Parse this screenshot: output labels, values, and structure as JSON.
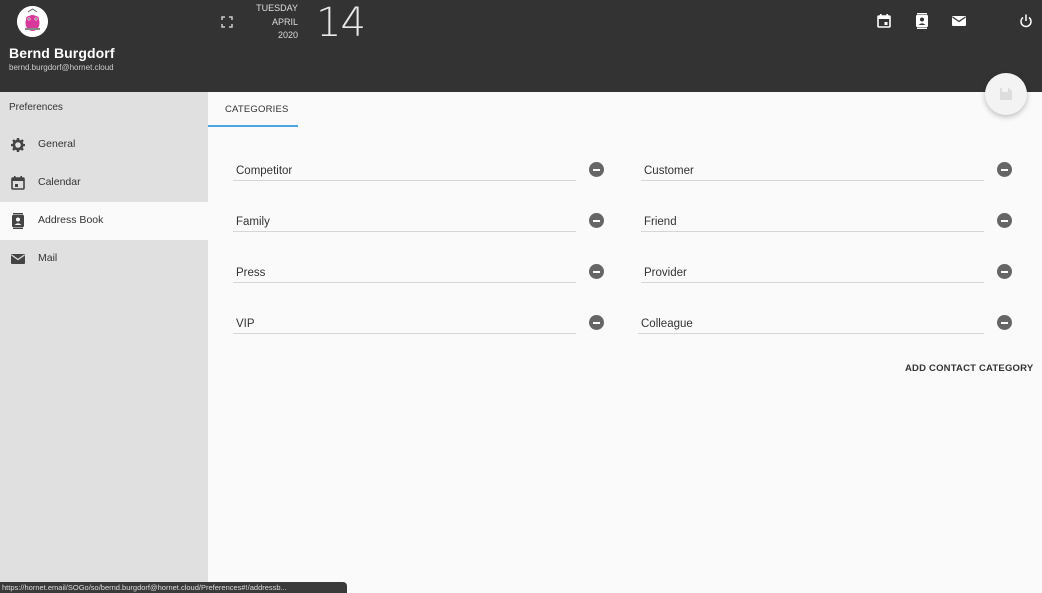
{
  "header": {
    "user_name": "Bernd Burgdorf",
    "user_email": "bernd.burgdorf@hornet.cloud",
    "weekday": "TUESDAY",
    "month": "APRIL",
    "year": "2020",
    "day": "14"
  },
  "sidebar": {
    "title": "Preferences",
    "items": [
      {
        "label": "General",
        "icon": "gear-icon"
      },
      {
        "label": "Calendar",
        "icon": "calendar-icon"
      },
      {
        "label": "Address Book",
        "icon": "contacts-icon"
      },
      {
        "label": "Mail",
        "icon": "mail-icon"
      }
    ],
    "active": "Address Book"
  },
  "main": {
    "tab_label": "CATEGORIES",
    "categories": [
      "Competitor",
      "Customer",
      "Family",
      "Friend",
      "Press",
      "Provider",
      "VIP",
      "Colleague"
    ],
    "add_label": "ADD CONTACT CATEGORY"
  },
  "status_url": "https://hornet.email/SOGo/so/bernd.burgdorf@hornet.cloud/Preferences#!/addressb...",
  "colors": {
    "header_bg": "#333333",
    "sidebar_bg": "#e0e0e0",
    "accent": "#4fa3e0",
    "remove_icon": "#666666"
  }
}
